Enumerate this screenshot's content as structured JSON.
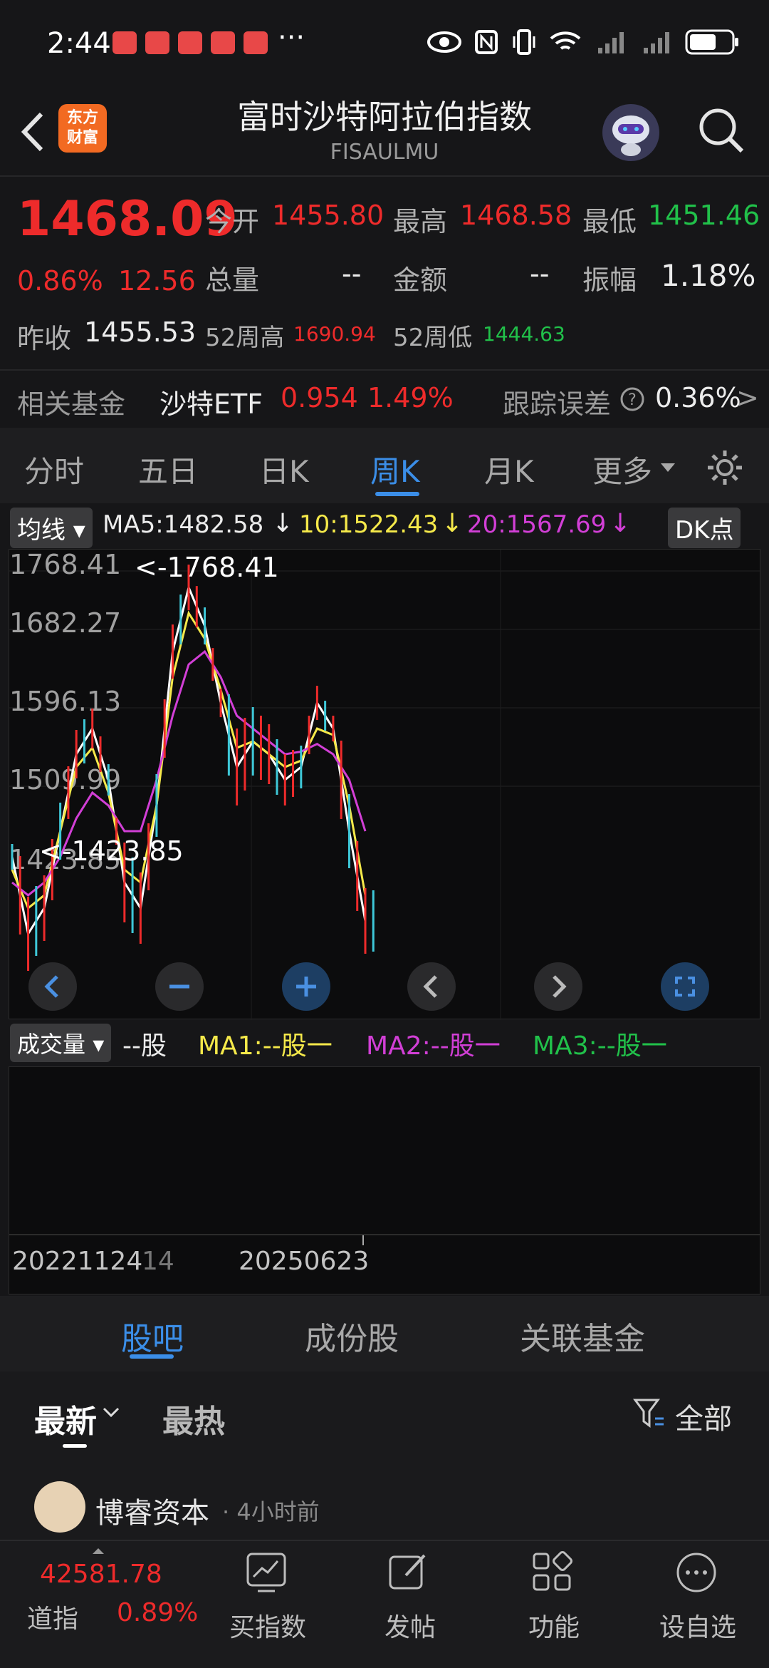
{
  "status": {
    "time": "2:44",
    "dots": "···"
  },
  "header": {
    "title": "富时沙特阿拉伯指数",
    "code": "FISAULMU",
    "logo_line1": "东方",
    "logo_line2": "财富"
  },
  "quote": {
    "price": "1468.09",
    "pct": "0.86%",
    "chg": "12.56",
    "open_label": "今开",
    "open": "1455.80",
    "high_label": "最高",
    "high": "1468.58",
    "low_label": "最低",
    "low": "1451.46",
    "vol_label": "总量",
    "vol": "--",
    "amt_label": "金额",
    "amt": "--",
    "amp_label": "振幅",
    "amp": "1.18%",
    "prev_label": "昨收",
    "prev": "1455.53",
    "w52h_label": "52周高",
    "w52h": "1690.94",
    "w52l_label": "52周低",
    "w52l": "1444.63"
  },
  "fund": {
    "label": "相关基金",
    "name": "沙特ETF",
    "price": "0.954",
    "pct": "1.49%",
    "track_label": "跟踪误差",
    "track": "0.36%",
    "arrow": ">"
  },
  "tabs": [
    "分时",
    "五日",
    "日K",
    "周K",
    "月K",
    "更多"
  ],
  "ma": {
    "chip": "均线",
    "ma5": "MA5:1482.58",
    "ma10": "10:1522.43",
    "ma20": "20:1567.69",
    "arrow": "↓",
    "dk": "DK点"
  },
  "chart_data": {
    "type": "line",
    "y_ticks": [
      "1768.41",
      "1682.27",
      "1596.13",
      "1509.99",
      "1423.85"
    ],
    "max_label": "<-1768.41",
    "min_label": "<-1423.85",
    "ylim": [
      1423.85,
      1768.41
    ],
    "x_labels": [
      "20221124",
      "14",
      "20250623"
    ],
    "series": [
      {
        "name": "MA5",
        "color": "#ffffff",
        "values": [
          1540,
          1480,
          1500,
          1560,
          1620,
          1640,
          1600,
          1520,
          1500,
          1580,
          1700,
          1750,
          1720,
          1660,
          1610,
          1630,
          1620,
          1600,
          1610,
          1660,
          1640,
          1560,
          1490
        ]
      },
      {
        "name": "10",
        "color": "#f5e94a",
        "values": [
          1530,
          1500,
          1510,
          1560,
          1610,
          1625,
          1590,
          1530,
          1520,
          1580,
          1680,
          1730,
          1710,
          1670,
          1625,
          1630,
          1620,
          1610,
          1615,
          1640,
          1635,
          1580,
          1510
        ]
      },
      {
        "name": "20",
        "color": "#d23fd6",
        "values": [
          1520,
          1510,
          1520,
          1540,
          1570,
          1590,
          1580,
          1560,
          1560,
          1600,
          1650,
          1690,
          1700,
          1680,
          1650,
          1640,
          1630,
          1620,
          1622,
          1628,
          1620,
          1600,
          1560
        ]
      }
    ]
  },
  "volume": {
    "chip": "成交量",
    "unit": "--股",
    "ma1": "MA1:--股一",
    "ma2": "MA2:--股一",
    "ma3": "MA3:--股一"
  },
  "section_tabs": [
    "股吧",
    "成份股",
    "关联基金"
  ],
  "filter": {
    "latest": "最新",
    "hot": "最热",
    "all": "全部"
  },
  "post": {
    "author": "博睿资本",
    "time": "· 4小时前"
  },
  "ticker": {
    "value": "42581.78",
    "name": "道指",
    "pct": "0.89%"
  },
  "nav": [
    "买指数",
    "发帖",
    "功能",
    "设自选"
  ],
  "colors": {
    "up": "#ee2b2b",
    "down": "#21c14a",
    "accent": "#3b8ee8"
  }
}
